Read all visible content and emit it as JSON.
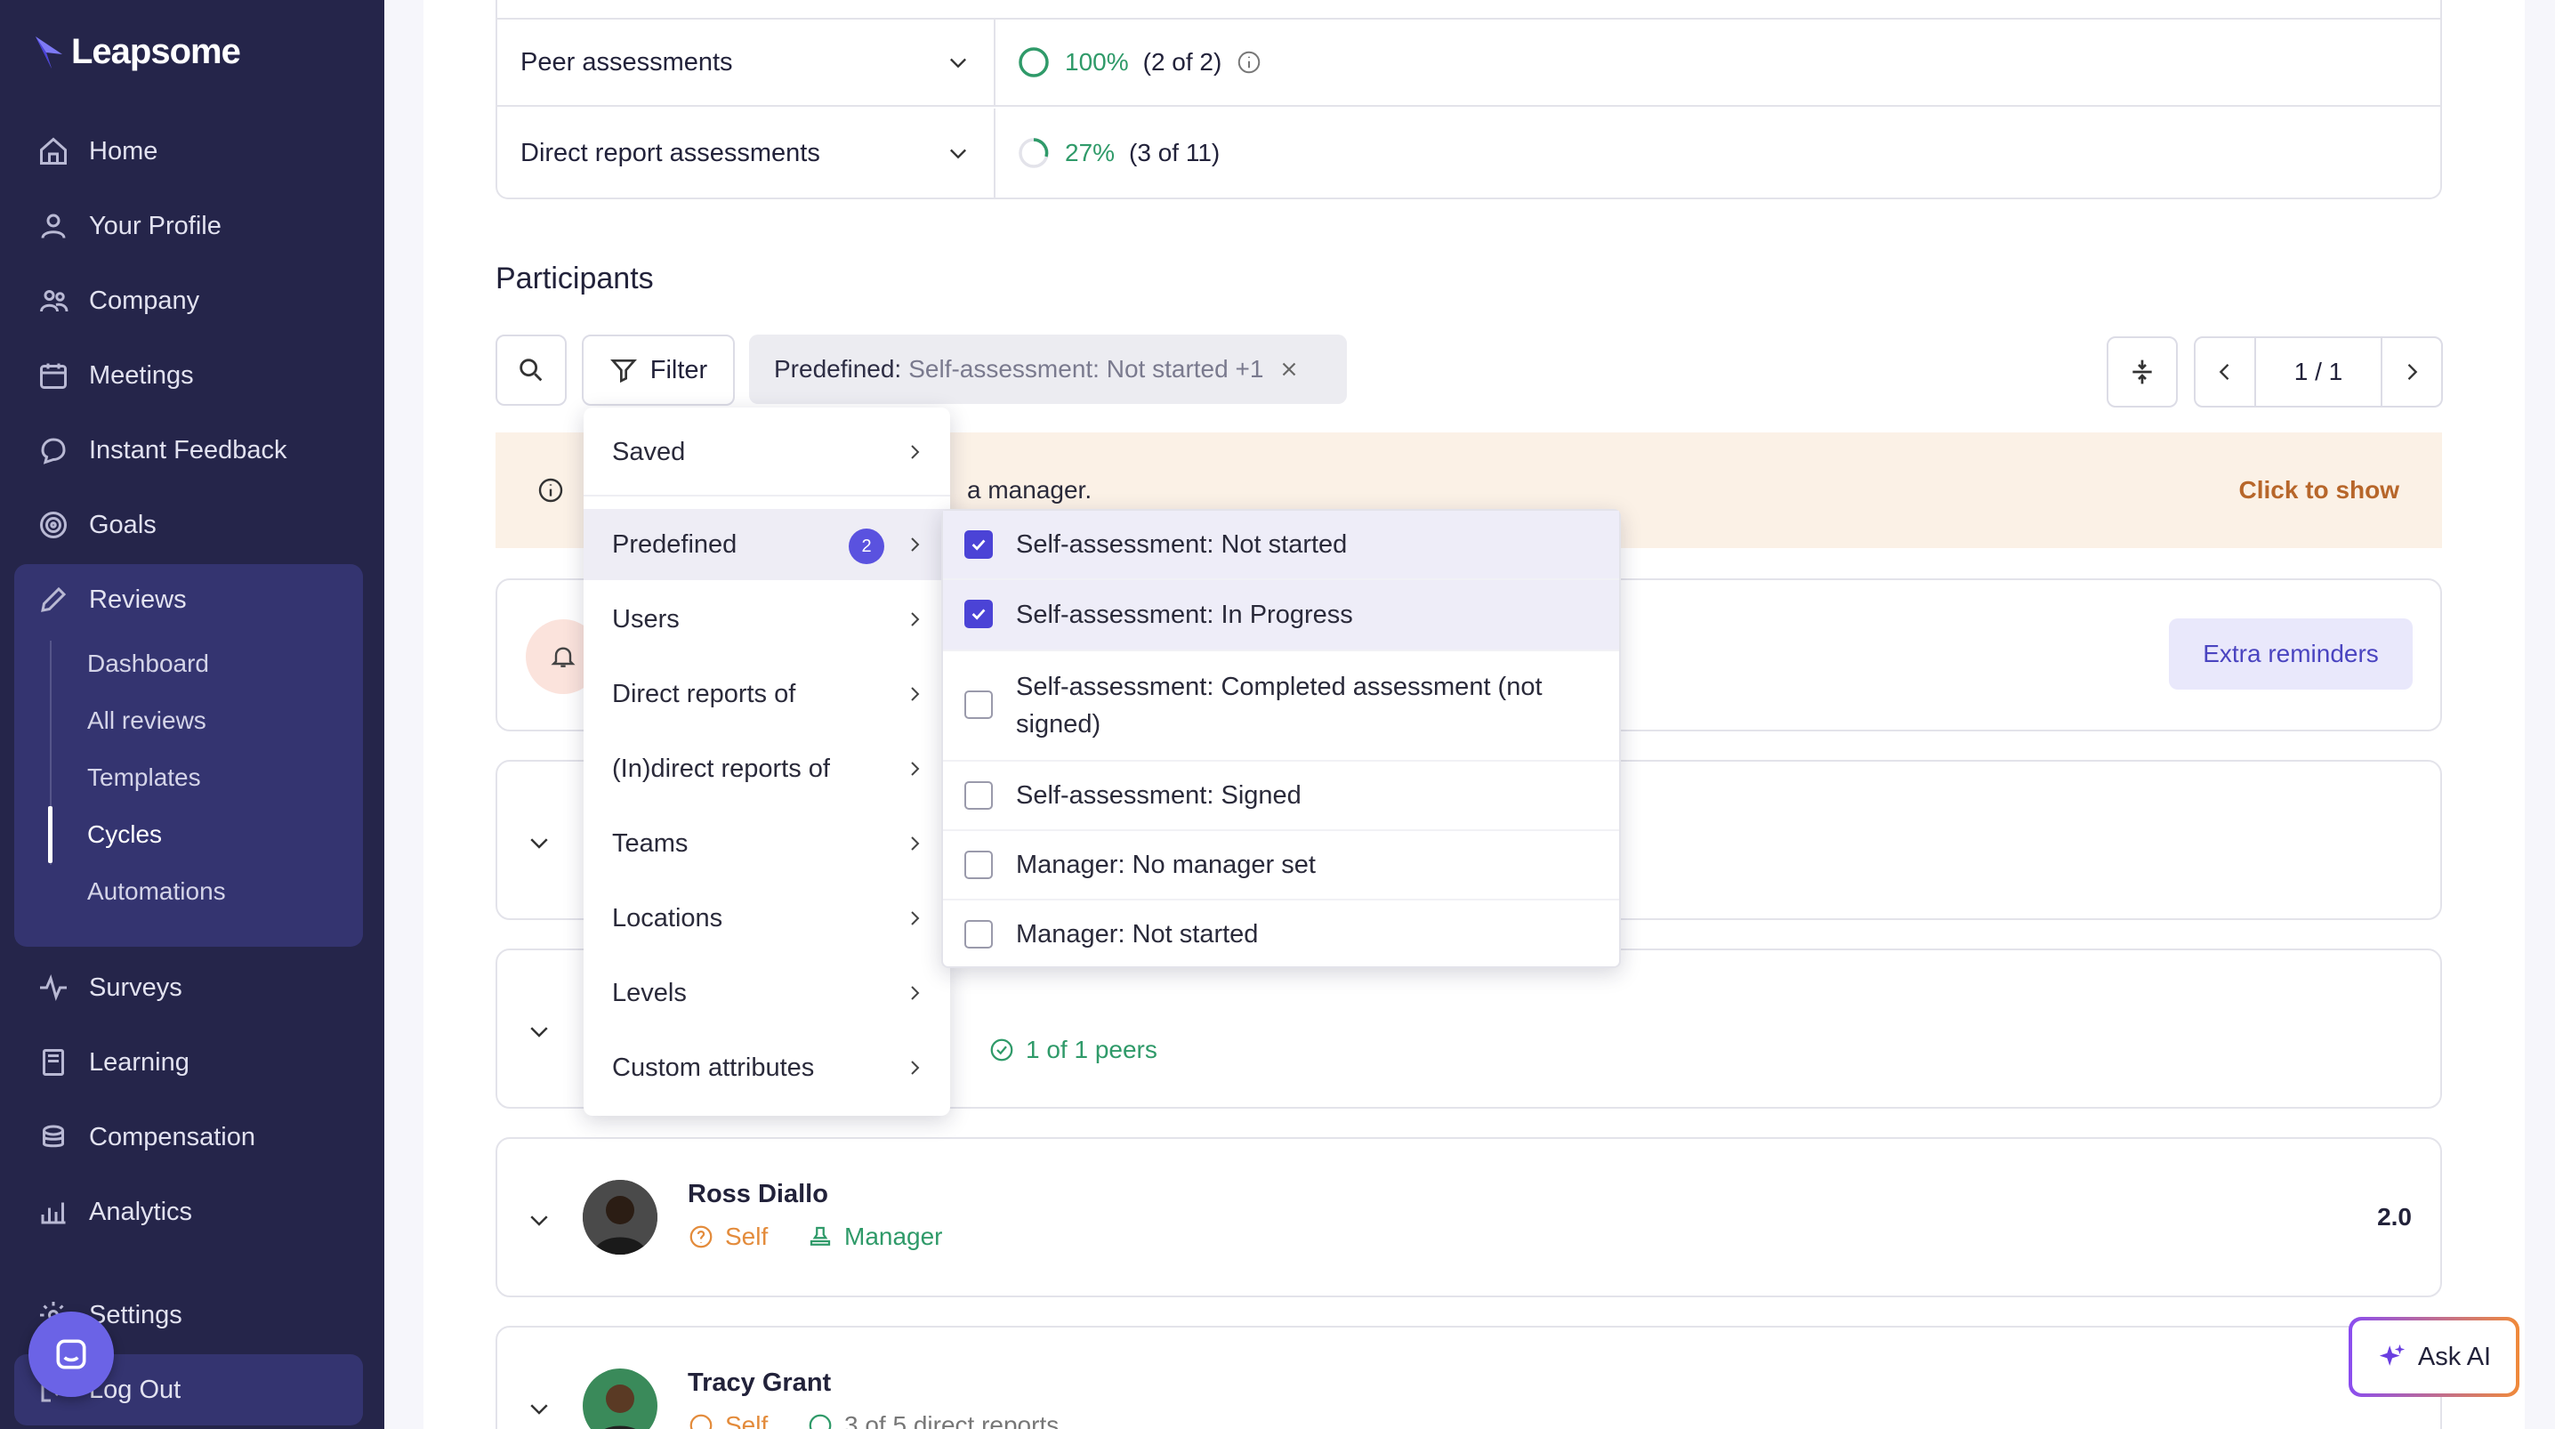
{
  "brand": {
    "name": "Leapsome"
  },
  "sidebar": {
    "items": [
      {
        "label": "Home",
        "icon": "home-icon"
      },
      {
        "label": "Your Profile",
        "icon": "user-icon"
      },
      {
        "label": "Company",
        "icon": "people-icon"
      },
      {
        "label": "Meetings",
        "icon": "calendar-icon"
      },
      {
        "label": "Instant Feedback",
        "icon": "chat-icon"
      },
      {
        "label": "Goals",
        "icon": "target-icon"
      },
      {
        "label": "Reviews",
        "icon": "pencil-icon"
      },
      {
        "label": "Surveys",
        "icon": "pulse-icon"
      },
      {
        "label": "Learning",
        "icon": "book-icon"
      },
      {
        "label": "Compensation",
        "icon": "coins-icon"
      },
      {
        "label": "Analytics",
        "icon": "chart-icon"
      },
      {
        "label": "Settings",
        "icon": "gear-icon"
      },
      {
        "label": "Log Out",
        "icon": "logout-icon"
      }
    ],
    "reviews_sub": [
      "Dashboard",
      "All reviews",
      "Templates",
      "Cycles",
      "Automations"
    ],
    "active_sub": "Cycles"
  },
  "assessments": [
    {
      "label": "Peer assessments",
      "percent": "100%",
      "count": "(2 of 2)"
    },
    {
      "label": "Direct report assessments",
      "percent": "27%",
      "count": "(3 of 11)"
    }
  ],
  "participants": {
    "title": "Participants",
    "filter_label": "Filter",
    "chip_key": "Predefined:",
    "chip_value": "Self-assessment: Not started +1",
    "pagination": "1 / 1",
    "banner_text": "a manager.",
    "banner_link": "Click to show",
    "extra_reminders": "Extra reminders",
    "peers_text": "1 of 1 peers"
  },
  "people": [
    {
      "name": "Ross Diallo",
      "self": "Self",
      "manager": "Manager",
      "score": "2.0"
    },
    {
      "name": "Tracy Grant",
      "self": "Self",
      "direct": "3 of 5 direct reports"
    }
  ],
  "filter_menu": {
    "items": [
      "Saved",
      "Predefined",
      "Users",
      "Direct reports of",
      "(In)direct reports of",
      "Teams",
      "Locations",
      "Levels",
      "Custom attributes"
    ],
    "predefined_count": "2"
  },
  "predefined_options": [
    {
      "label": "Self-assessment: Not started",
      "checked": true
    },
    {
      "label": "Self-assessment: In Progress",
      "checked": true
    },
    {
      "label": "Self-assessment: Completed assessment (not signed)",
      "checked": false
    },
    {
      "label": "Self-assessment: Signed",
      "checked": false
    },
    {
      "label": "Manager: No manager set",
      "checked": false
    },
    {
      "label": "Manager: Not started",
      "checked": false
    }
  ],
  "ask_ai": "Ask AI",
  "colors": {
    "sidebar": "#25254a",
    "accent": "#4b43d6",
    "green": "#2f9a69",
    "orange": "#e38b3b"
  }
}
